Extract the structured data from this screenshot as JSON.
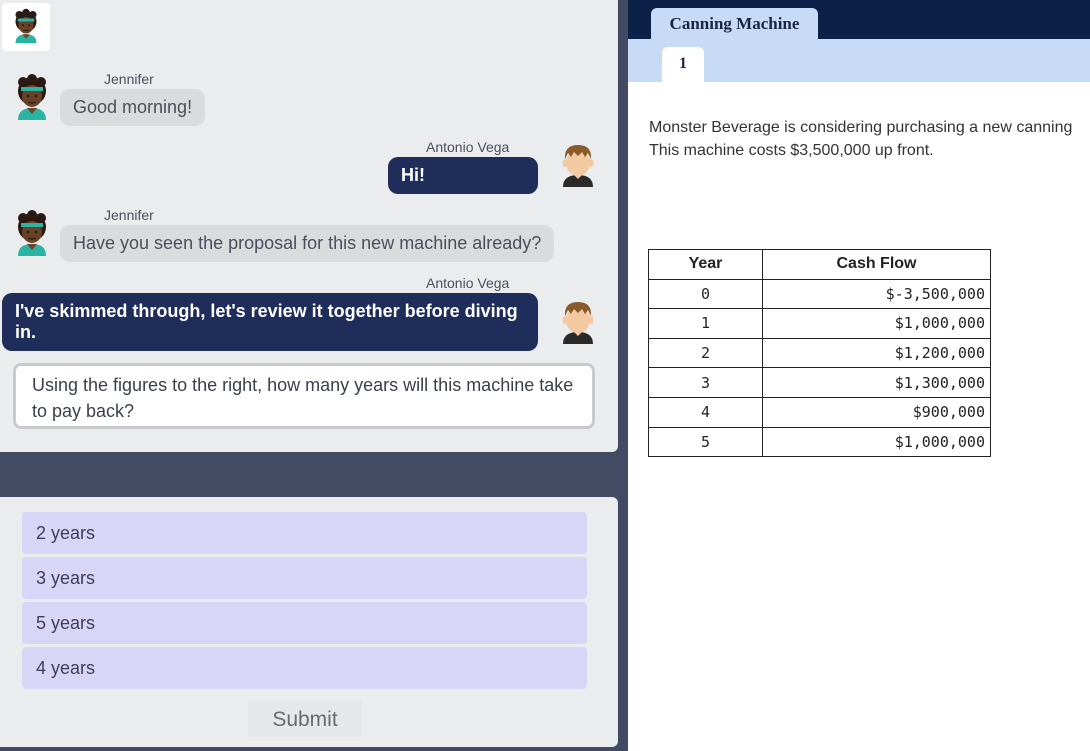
{
  "chat": {
    "messages": [
      {
        "sender": "Jennifer",
        "text": "Good morning!"
      },
      {
        "sender": "Antonio Vega",
        "text": "Hi!"
      },
      {
        "sender": "Jennifer",
        "text": "Have you seen the proposal for this new machine already?"
      },
      {
        "sender": "Antonio Vega",
        "text": "I've skimmed through, let's review it together before diving in."
      }
    ],
    "question": "Using the figures to the right, how many years will this machine take to pay back?"
  },
  "answers": {
    "options": [
      "2 years",
      "3 years",
      "5 years",
      "4 years"
    ],
    "submit_label": "Submit"
  },
  "document": {
    "tab_title": "Canning Machine",
    "page_tab": "1",
    "description_line1": "Monster Beverage is considering purchasing a new canning",
    "description_line2": "This machine costs $3,500,000 up front.",
    "table": {
      "headers": [
        "Year",
        "Cash Flow"
      ],
      "rows": [
        {
          "year": "0",
          "cash_flow": "$-3,500,000"
        },
        {
          "year": "1",
          "cash_flow": "$1,000,000"
        },
        {
          "year": "2",
          "cash_flow": "$1,200,000"
        },
        {
          "year": "3",
          "cash_flow": "$1,300,000"
        },
        {
          "year": "4",
          "cash_flow": "$900,000"
        },
        {
          "year": "5",
          "cash_flow": "$1,000,000"
        }
      ]
    }
  },
  "colors": {
    "user_bubble": "#1f2d5a",
    "other_bubble": "#dadbdd",
    "option_fill": "#d9d5f7",
    "tab_bar": "#0c2148",
    "tab_fill": "#c7dbf7"
  }
}
